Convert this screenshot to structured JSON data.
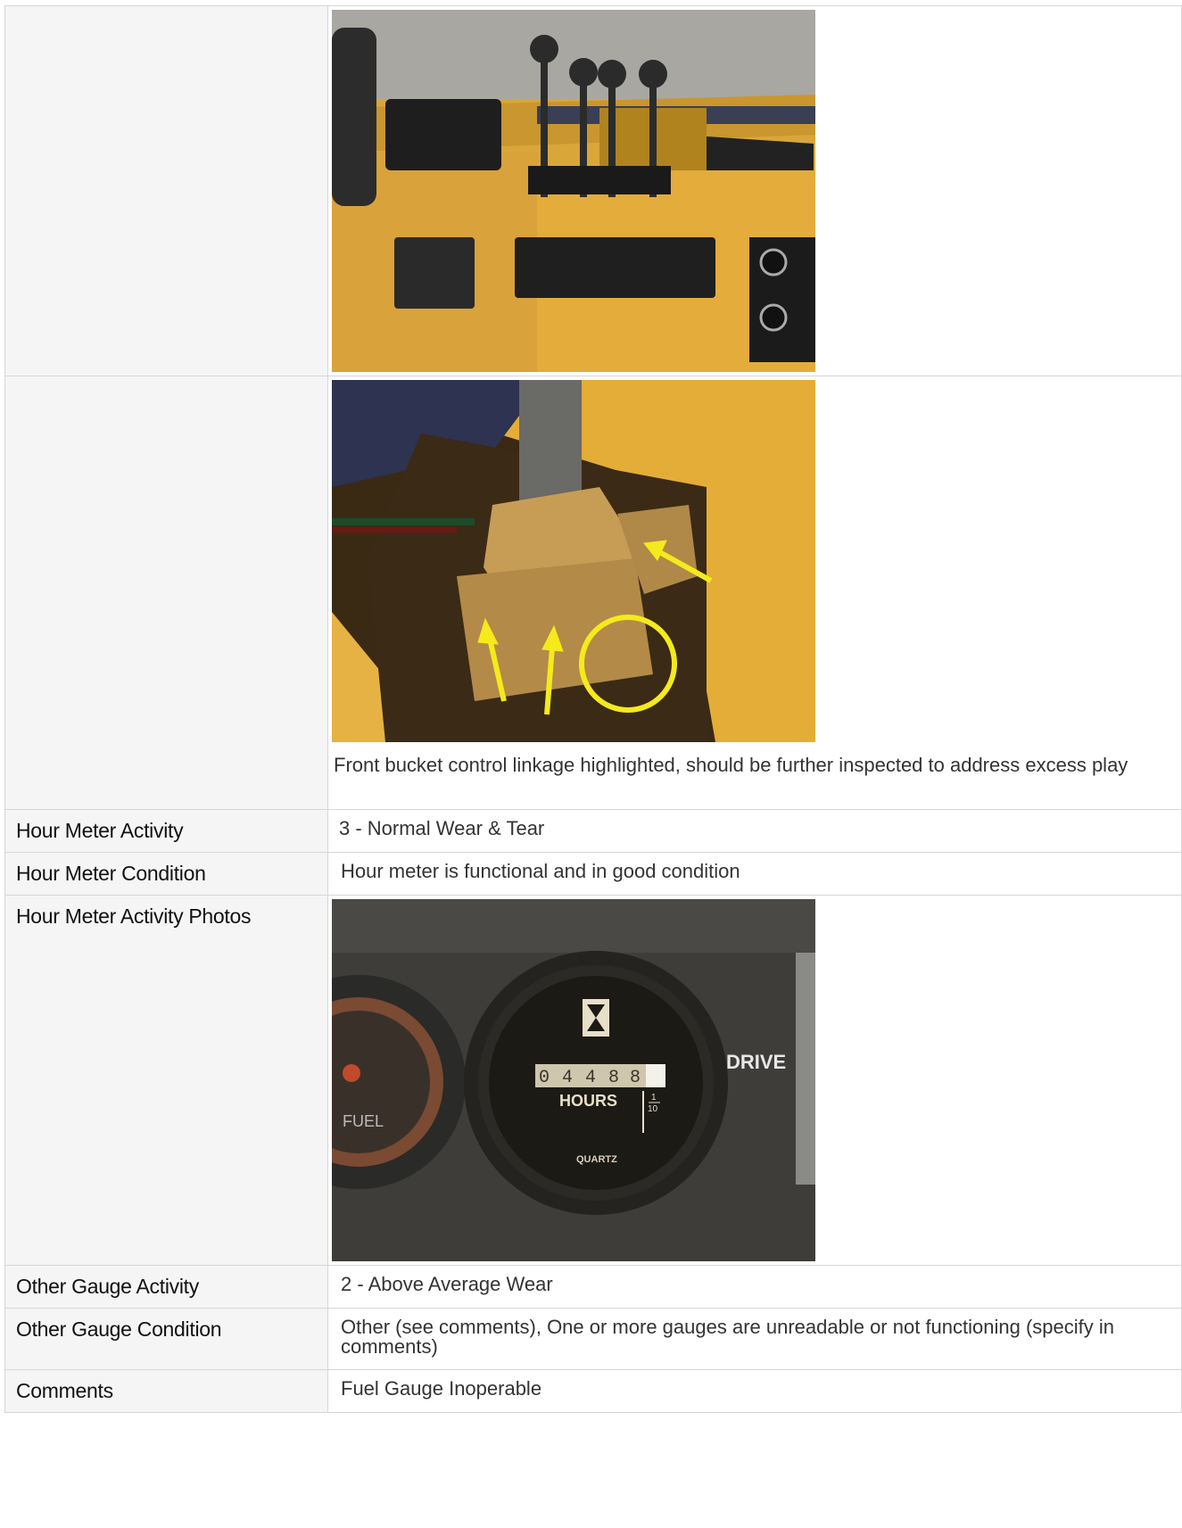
{
  "rows": [
    {
      "label": "",
      "type": "photo",
      "photo": "control-levers-photo"
    },
    {
      "label": "",
      "type": "photo",
      "photo": "linkage-photo",
      "caption": "Front bucket control linkage highlighted, should be further inspected to address excess play"
    },
    {
      "label": "Hour Meter Activity",
      "value": "3 - Normal Wear & Tear"
    },
    {
      "label": "Hour Meter Condition",
      "value": "Hour meter is functional and in good condition"
    },
    {
      "label": "Hour Meter Activity Photos",
      "type": "photo",
      "photo": "hour-meter-photo"
    },
    {
      "label": "Other Gauge Activity",
      "value": "2 - Above Average Wear"
    },
    {
      "label": "Other Gauge Condition",
      "value": "Other (see comments), One or more gauges are unreadable or not functioning (specify in comments)"
    },
    {
      "label": "Comments",
      "value": "Fuel Gauge Inoperable"
    }
  ],
  "photo_text": {
    "hours_digits": [
      "0",
      "4",
      "4",
      "8",
      "8"
    ],
    "hours_label": "HOURS",
    "tenths_num": "1",
    "tenths_den": "10",
    "quartz_label": "QUARTZ",
    "drive_label": "DRIVE",
    "fuel_label": "FUEL"
  },
  "colors": {
    "machine_yellow": "#e8b43a",
    "arrow_yellow": "#f4ea1c",
    "border": "#d6d6d6",
    "label_bg": "#f5f5f5"
  }
}
